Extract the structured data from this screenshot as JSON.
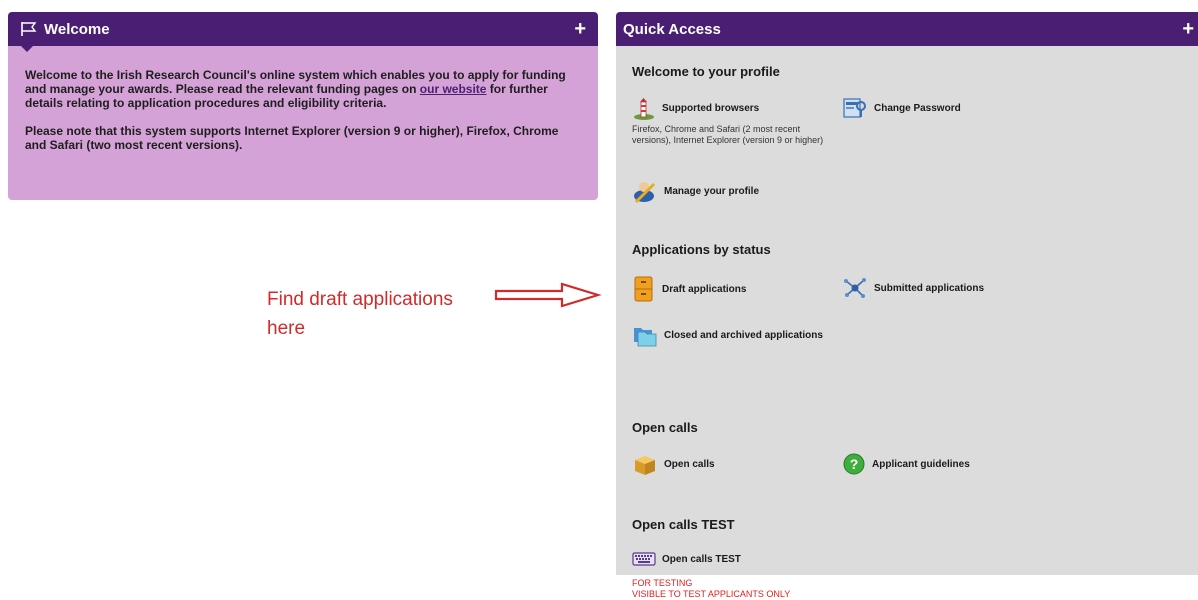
{
  "welcome": {
    "title": "Welcome",
    "para1_before": "Welcome to the Irish Research Council's online system which enables you to apply for funding and manage your awards. Please read the relevant funding pages on ",
    "link": "our website",
    "para1_after": " for further details relating to application procedures and eligibility criteria.",
    "para2": "Please note that this system supports Internet Explorer (version 9 or higher), Firefox, Chrome and Safari (two most recent versions).",
    "add_label": "+"
  },
  "quick": {
    "title": "Quick Access",
    "add_label": "+",
    "profile": {
      "heading": "Welcome to your profile",
      "supported_browsers": "Supported browsers",
      "browsers_note": "Firefox, Chrome and Safari (2 most recent versions), Internet Explorer (version 9 or higher)",
      "change_password": "Change Password",
      "manage_profile": "Manage your profile"
    },
    "status": {
      "heading": "Applications by status",
      "draft": "Draft applications",
      "submitted": "Submitted applications",
      "closed": "Closed and archived applications"
    },
    "open_calls": {
      "heading": "Open calls",
      "open_calls": "Open calls",
      "guidelines": "Applicant guidelines"
    },
    "open_calls_test": {
      "heading": "Open calls TEST",
      "item": "Open calls TEST",
      "note1": "FOR TESTING",
      "note2": "VISIBLE TO TEST APPLICANTS ONLY"
    }
  },
  "annotation": {
    "line1": "Find draft applications",
    "line2": "here"
  },
  "colors": {
    "header": "#4a1f73",
    "welcome_bg": "#d4a2d6",
    "quick_bg": "#dcdcdc",
    "annotation": "#d22a2a"
  }
}
